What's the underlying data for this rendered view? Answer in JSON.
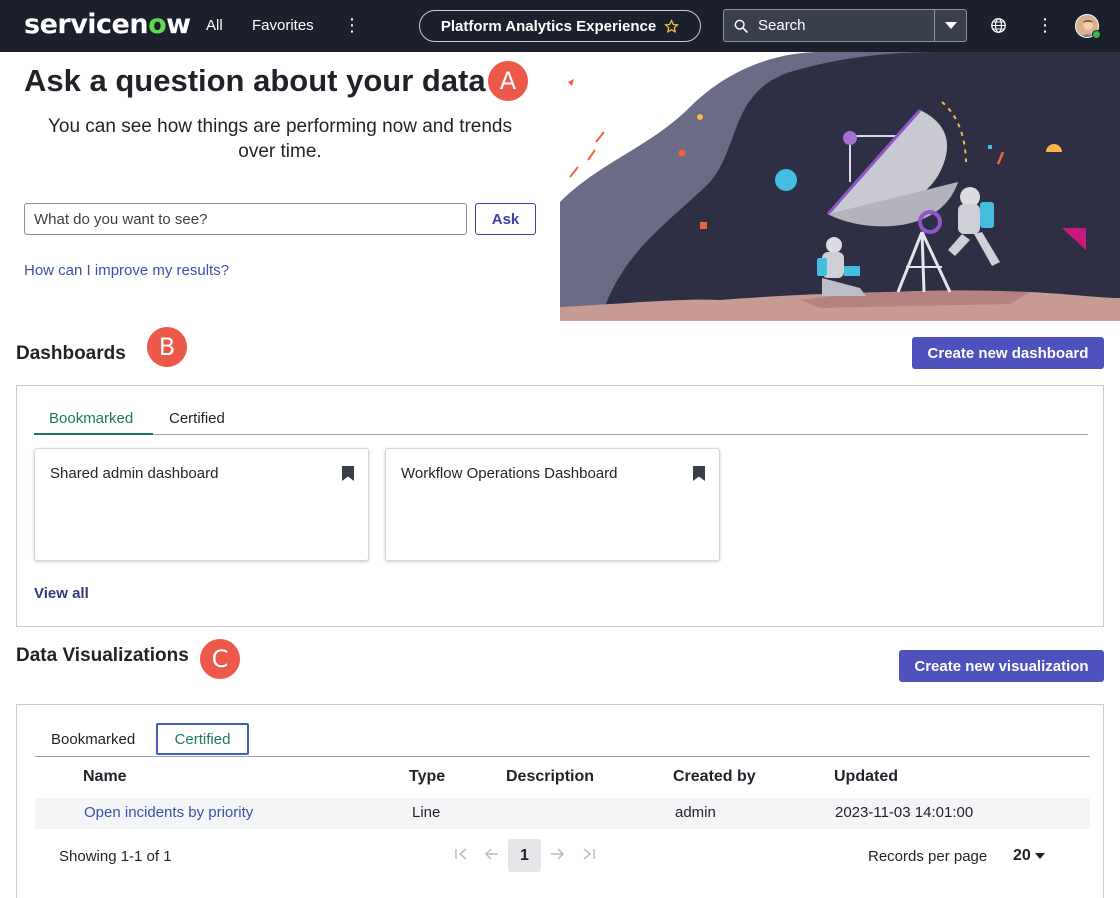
{
  "topbar": {
    "logo_prefix": "servicen",
    "logo_o": "o",
    "logo_suffix": "w",
    "nav_all": "All",
    "nav_favorites": "Favorites",
    "more_icon": "⋮",
    "app_name": "Platform Analytics Experience",
    "search_placeholder": "Search"
  },
  "hero": {
    "title": "Ask a question about your data",
    "badge": "A",
    "subtitle": "You can see how things are performing now and trends over time.",
    "input_placeholder": "What do you want to see?",
    "ask_label": "Ask",
    "improve_link": "How can I improve my results?"
  },
  "dashboards": {
    "title": "Dashboards",
    "badge": "B",
    "create_label": "Create new dashboard",
    "tabs": [
      {
        "label": "Bookmarked",
        "active": true
      },
      {
        "label": "Certified",
        "active": false
      }
    ],
    "cards": [
      {
        "title": "Shared admin dashboard"
      },
      {
        "title": "Workflow Operations Dashboard"
      }
    ],
    "view_all": "View all"
  },
  "visualizations": {
    "title": "Data Visualizations",
    "badge": "C",
    "create_label": "Create new visualization",
    "tabs": [
      {
        "label": "Bookmarked",
        "active": false
      },
      {
        "label": "Certified",
        "active": true
      }
    ],
    "columns": [
      "Name",
      "Type",
      "Description",
      "Created by",
      "Updated"
    ],
    "rows": [
      {
        "name": "Open incidents by priority",
        "type": "Line",
        "description": "",
        "created_by": "admin",
        "updated": "2023-11-03 14:01:00"
      }
    ],
    "showing": "Showing 1-1 of 1",
    "current_page": "1",
    "records_per_page_label": "Records per page",
    "records_per_page": "20"
  },
  "colors": {
    "topbar_bg": "#1c1f2c",
    "primary": "#4f52bd",
    "accent_green": "#1b7a5a",
    "badge_red": "#ec5849",
    "link_blue": "#3b4fb0"
  }
}
